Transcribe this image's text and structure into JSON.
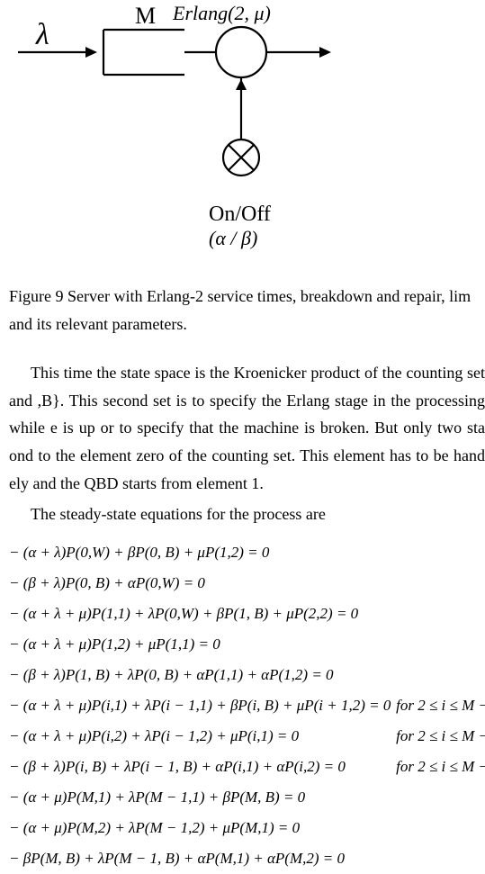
{
  "diagram": {
    "lambda": "λ",
    "M": "M",
    "erlang": "Erlang(2, μ)",
    "onoff": "On/Off",
    "alphabeta": "(α / β)"
  },
  "caption": "Figure 9 Server with Erlang-2 service times, breakdown and repair, lim  and its relevant parameters.",
  "para1": "This time the state space is the Kroenicker product of the counting set and ,B}.  This second set is to specify the Erlang stage in the processing while e is up or to specify that the machine is broken.  But only two sta ond to the element zero of the counting set.  This element has to be hand ely and the QBD starts from element 1.",
  "para2": "The steady-state equations for the process are",
  "equations": [
    {
      "eq": "− (α + λ)P(0,W) + βP(0, B) + μP(1,2) = 0",
      "cond": ""
    },
    {
      "eq": "− (β + λ)P(0, B) + αP(0,W) = 0",
      "cond": ""
    },
    {
      "eq": "− (α + λ + μ)P(1,1) + λP(0,W) + βP(1, B) + μP(2,2) = 0",
      "cond": ""
    },
    {
      "eq": "− (α + λ + μ)P(1,2) + μP(1,1) = 0",
      "cond": ""
    },
    {
      "eq": "− (β + λ)P(1, B) + λP(0, B) + αP(1,1) + αP(1,2) = 0",
      "cond": ""
    },
    {
      "eq": "− (α + λ + μ)P(i,1) + λP(i − 1,1) + βP(i, B) + μP(i + 1,2) = 0",
      "cond": "for 2 ≤ i ≤ M −"
    },
    {
      "eq": "− (α + λ + μ)P(i,2) + λP(i − 1,2) + μP(i,1) = 0",
      "cond": "for 2 ≤ i ≤ M −"
    },
    {
      "eq": "− (β + λ)P(i, B) + λP(i − 1, B) + αP(i,1) + αP(i,2) = 0",
      "cond": "for 2 ≤ i ≤ M −"
    },
    {
      "eq": "− (α + μ)P(M,1) + λP(M − 1,1) + βP(M, B) = 0",
      "cond": ""
    },
    {
      "eq": "− (α + μ)P(M,2) + λP(M − 1,2) + μP(M,1) = 0",
      "cond": ""
    },
    {
      "eq": "− βP(M, B) + λP(M − 1, B) + αP(M,1) + αP(M,2) = 0",
      "cond": ""
    }
  ]
}
